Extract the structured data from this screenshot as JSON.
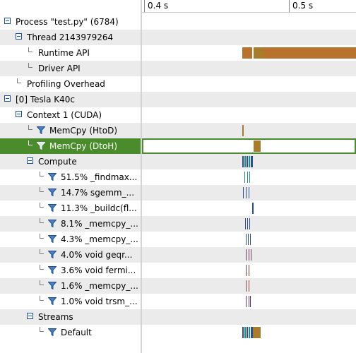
{
  "ruler": {
    "ticks": [
      {
        "label": "0.4 s"
      },
      {
        "label": "0.5 s"
      }
    ]
  },
  "colors": {
    "selection": "#4a8b2c",
    "api": "#b8722e",
    "memcpy": "#a87c2a",
    "kernel_blue": "#2c4f8a",
    "kernel_teal": "#2a8a8a",
    "stream": "#8a6b2a",
    "accent": "#1a4f9e"
  },
  "tree": [
    {
      "id": "process",
      "label": "Process \"test.py\" (6784)",
      "kind": "expander",
      "icon": "minus-icon"
    },
    {
      "id": "thread",
      "label": "Thread 2143979264",
      "kind": "expander",
      "icon": "minus-icon"
    },
    {
      "id": "runtime-api",
      "label": "Runtime API",
      "kind": "leaf"
    },
    {
      "id": "driver-api",
      "label": "Driver API",
      "kind": "leaf"
    },
    {
      "id": "profiling-overhead",
      "label": "Profiling Overhead",
      "kind": "leaf"
    },
    {
      "id": "device",
      "label": "[0] Tesla K40c",
      "kind": "expander",
      "icon": "minus-icon"
    },
    {
      "id": "context",
      "label": "Context 1 (CUDA)",
      "kind": "expander",
      "icon": "minus-icon"
    },
    {
      "id": "memcpy-htod",
      "label": "MemCpy (HtoD)",
      "kind": "filter",
      "icon": "filter-icon"
    },
    {
      "id": "memcpy-dtoh",
      "label": "MemCpy (DtoH)",
      "kind": "filter",
      "icon": "filter-icon",
      "selected": true
    },
    {
      "id": "compute",
      "label": "Compute",
      "kind": "expander",
      "icon": "minus-icon"
    },
    {
      "id": "k1",
      "label": "51.5% _findmax...",
      "kind": "filter",
      "icon": "filter-icon"
    },
    {
      "id": "k2",
      "label": "14.7% sgemm_...",
      "kind": "filter",
      "icon": "filter-icon"
    },
    {
      "id": "k3",
      "label": "11.3% _buildc(fl...",
      "kind": "filter",
      "icon": "filter-icon"
    },
    {
      "id": "k4",
      "label": "8.1% _memcpy_...",
      "kind": "filter",
      "icon": "filter-icon"
    },
    {
      "id": "k5",
      "label": "4.3% _memcpy_...",
      "kind": "filter",
      "icon": "filter-icon"
    },
    {
      "id": "k6",
      "label": "4.0% void geqr...",
      "kind": "filter",
      "icon": "filter-icon"
    },
    {
      "id": "k7",
      "label": "3.6% void fermi...",
      "kind": "filter",
      "icon": "filter-icon"
    },
    {
      "id": "k8",
      "label": "1.6% _memcpy_...",
      "kind": "filter",
      "icon": "filter-icon"
    },
    {
      "id": "k9",
      "label": "1.0% void trsm_...",
      "kind": "filter",
      "icon": "filter-icon"
    },
    {
      "id": "streams",
      "label": "Streams",
      "kind": "expander",
      "icon": "minus-icon"
    },
    {
      "id": "default-stream",
      "label": "Default",
      "kind": "filter",
      "icon": "filter-icon"
    }
  ]
}
